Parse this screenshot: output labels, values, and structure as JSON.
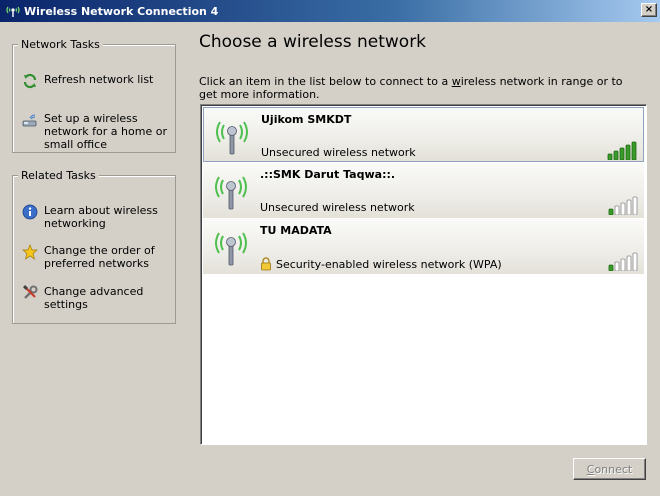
{
  "window": {
    "title": "Wireless Network Connection 4",
    "close_label": "×"
  },
  "sidebar": {
    "network_tasks": {
      "heading": "Network Tasks",
      "items": [
        {
          "label": "Refresh network list",
          "icon": "refresh-icon"
        },
        {
          "label": "Set up a wireless network for a home or small office",
          "icon": "wireless-setup-icon"
        }
      ]
    },
    "related_tasks": {
      "heading": "Related Tasks",
      "items": [
        {
          "label": "Learn about wireless networking",
          "icon": "info-icon"
        },
        {
          "label": "Change the order of preferred networks",
          "icon": "star-icon"
        },
        {
          "label": "Change advanced settings",
          "icon": "tools-icon"
        }
      ]
    }
  },
  "main": {
    "heading": "Choose a wireless network",
    "instructions_pre": "Click an item in the list below to connect to a ",
    "instructions_link": "w",
    "instructions_post": "ireless network in range or to get more information.",
    "networks": [
      {
        "name": "Ujikom SMKDT",
        "security": "Unsecured wireless network",
        "secured": false,
        "signal_bars": 5,
        "selected": true
      },
      {
        "name": ".::SMK Darut Taqwa::.",
        "security": "Unsecured wireless network",
        "secured": false,
        "signal_bars": 1,
        "selected": false
      },
      {
        "name": "TU MADATA",
        "security": "Security-enabled wireless network (WPA)",
        "secured": true,
        "signal_bars": 1,
        "selected": false
      }
    ],
    "connect_button": {
      "mnemonic": "C",
      "rest": "onnect",
      "enabled": false
    }
  },
  "colors": {
    "titlebar_start": "#0a246a",
    "titlebar_end": "#a6caf0",
    "signal_green": "#3a9a2a",
    "window_bg": "#d4d0c8"
  }
}
